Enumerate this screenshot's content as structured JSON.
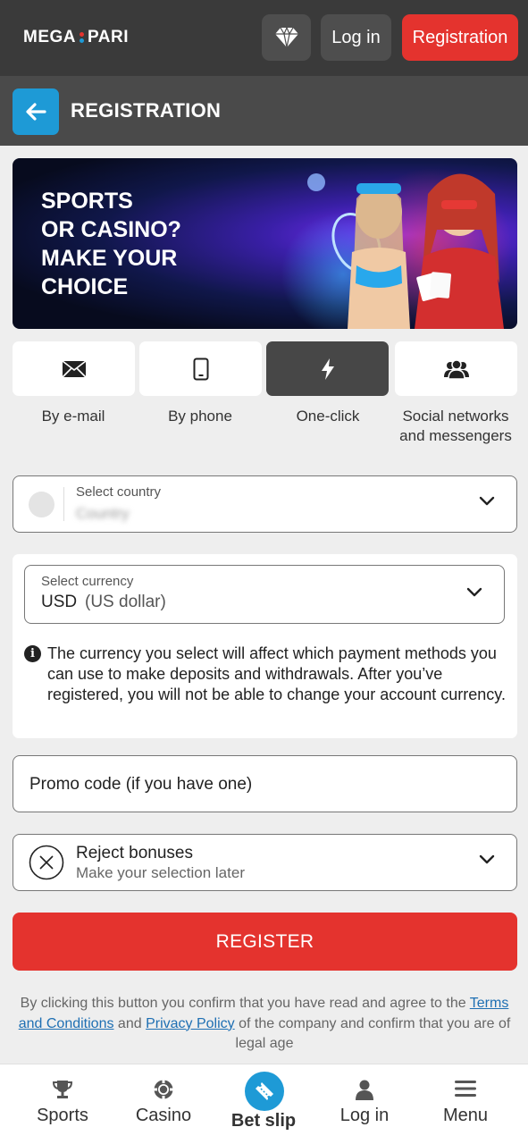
{
  "header": {
    "logo_left": "MEGA",
    "logo_right": "PARI",
    "login_label": "Log in",
    "register_label": "Registration"
  },
  "subheader": {
    "title": "REGISTRATION"
  },
  "banner": {
    "lines": [
      "SPORTS",
      "OR CASINO?",
      "MAKE YOUR",
      "CHOICE"
    ]
  },
  "tabs": [
    {
      "label": "By e-mail",
      "icon": "envelope-icon",
      "active": false
    },
    {
      "label": "By phone",
      "icon": "phone-icon",
      "active": false
    },
    {
      "label": "One-click",
      "icon": "lightning-icon",
      "active": true
    },
    {
      "label": "Social networks and messengers",
      "icon": "people-icon",
      "active": false
    }
  ],
  "country": {
    "label": "Select country",
    "value": "Country"
  },
  "currency": {
    "label": "Select currency",
    "code": "USD",
    "name": "(US dollar)",
    "info": "The currency you select will affect which payment methods you can use to make deposits and withdrawals. After you’ve registered, you will not be able to change your account currency."
  },
  "promo": {
    "placeholder": "Promo code (if you have one)"
  },
  "bonus": {
    "title": "Reject bonuses",
    "subtitle": "Make your selection later"
  },
  "register_button": "REGISTER",
  "terms": {
    "part1": "By clicking this button you confirm that you have read and agree to the",
    "terms_link": "Terms and Conditions",
    "part2": "and",
    "privacy_link": "Privacy Policy",
    "part3": "of the company and confirm that you are of legal age"
  },
  "bottom_nav": [
    {
      "label": "Sports",
      "icon": "trophy-icon"
    },
    {
      "label": "Casino",
      "icon": "casino-chip-icon"
    },
    {
      "label": "Bet slip",
      "icon": "ticket-icon"
    },
    {
      "label": "Log in",
      "icon": "user-icon"
    },
    {
      "label": "Menu",
      "icon": "hamburger-icon"
    }
  ],
  "colors": {
    "header_bg": "#3a3a3a",
    "accent_red": "#e4332e",
    "accent_blue": "#1e9ad6",
    "link": "#1e6fb3"
  }
}
